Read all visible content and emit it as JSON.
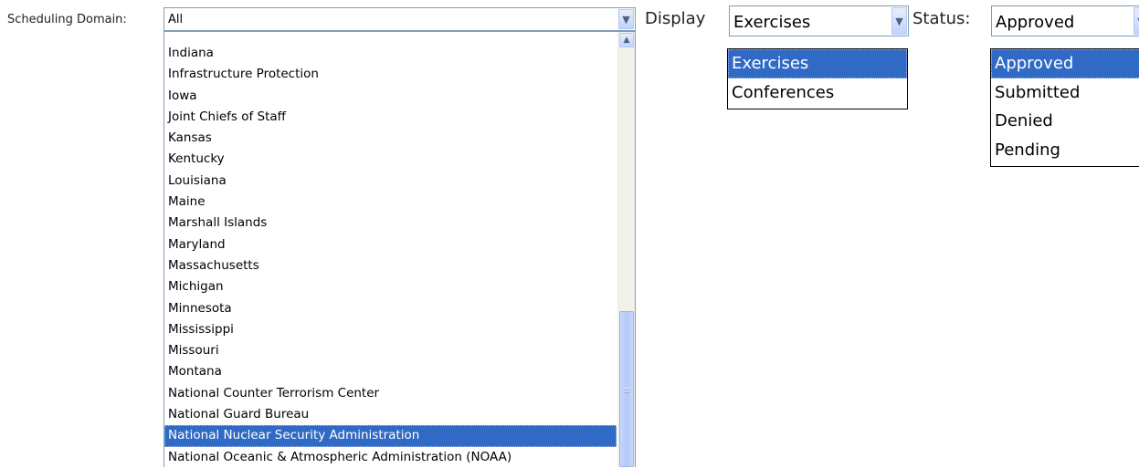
{
  "scheduling": {
    "label": "Scheduling Domain:",
    "value": "All",
    "options": [
      "Indiana",
      "Infrastructure Protection",
      "Iowa",
      "Joint Chiefs of Staff",
      "Kansas",
      "Kentucky",
      "Louisiana",
      "Maine",
      "Marshall Islands",
      "Maryland",
      "Massachusetts",
      "Michigan",
      "Minnesota",
      "Mississippi",
      "Missouri",
      "Montana",
      "National Counter Terrorism Center",
      "National Guard Bureau",
      "National Nuclear Security Administration",
      "National Oceanic & Atmospheric Administration (NOAA)"
    ],
    "highlighted": "National Nuclear Security Administration"
  },
  "display": {
    "label": "Display",
    "value": "Exercises",
    "options": [
      "Exercises",
      "Conferences"
    ],
    "highlighted": "Exercises"
  },
  "status": {
    "label": "Status:",
    "value": "Approved",
    "options": [
      "Approved",
      "Submitted",
      "Denied",
      "Pending"
    ],
    "highlighted": "Approved"
  },
  "icons": {
    "dropdown_arrow": "chevron-down-icon",
    "scroll_up": "chevron-up-icon"
  },
  "colors": {
    "selection": "#316ac5",
    "border": "#7f9db9"
  }
}
